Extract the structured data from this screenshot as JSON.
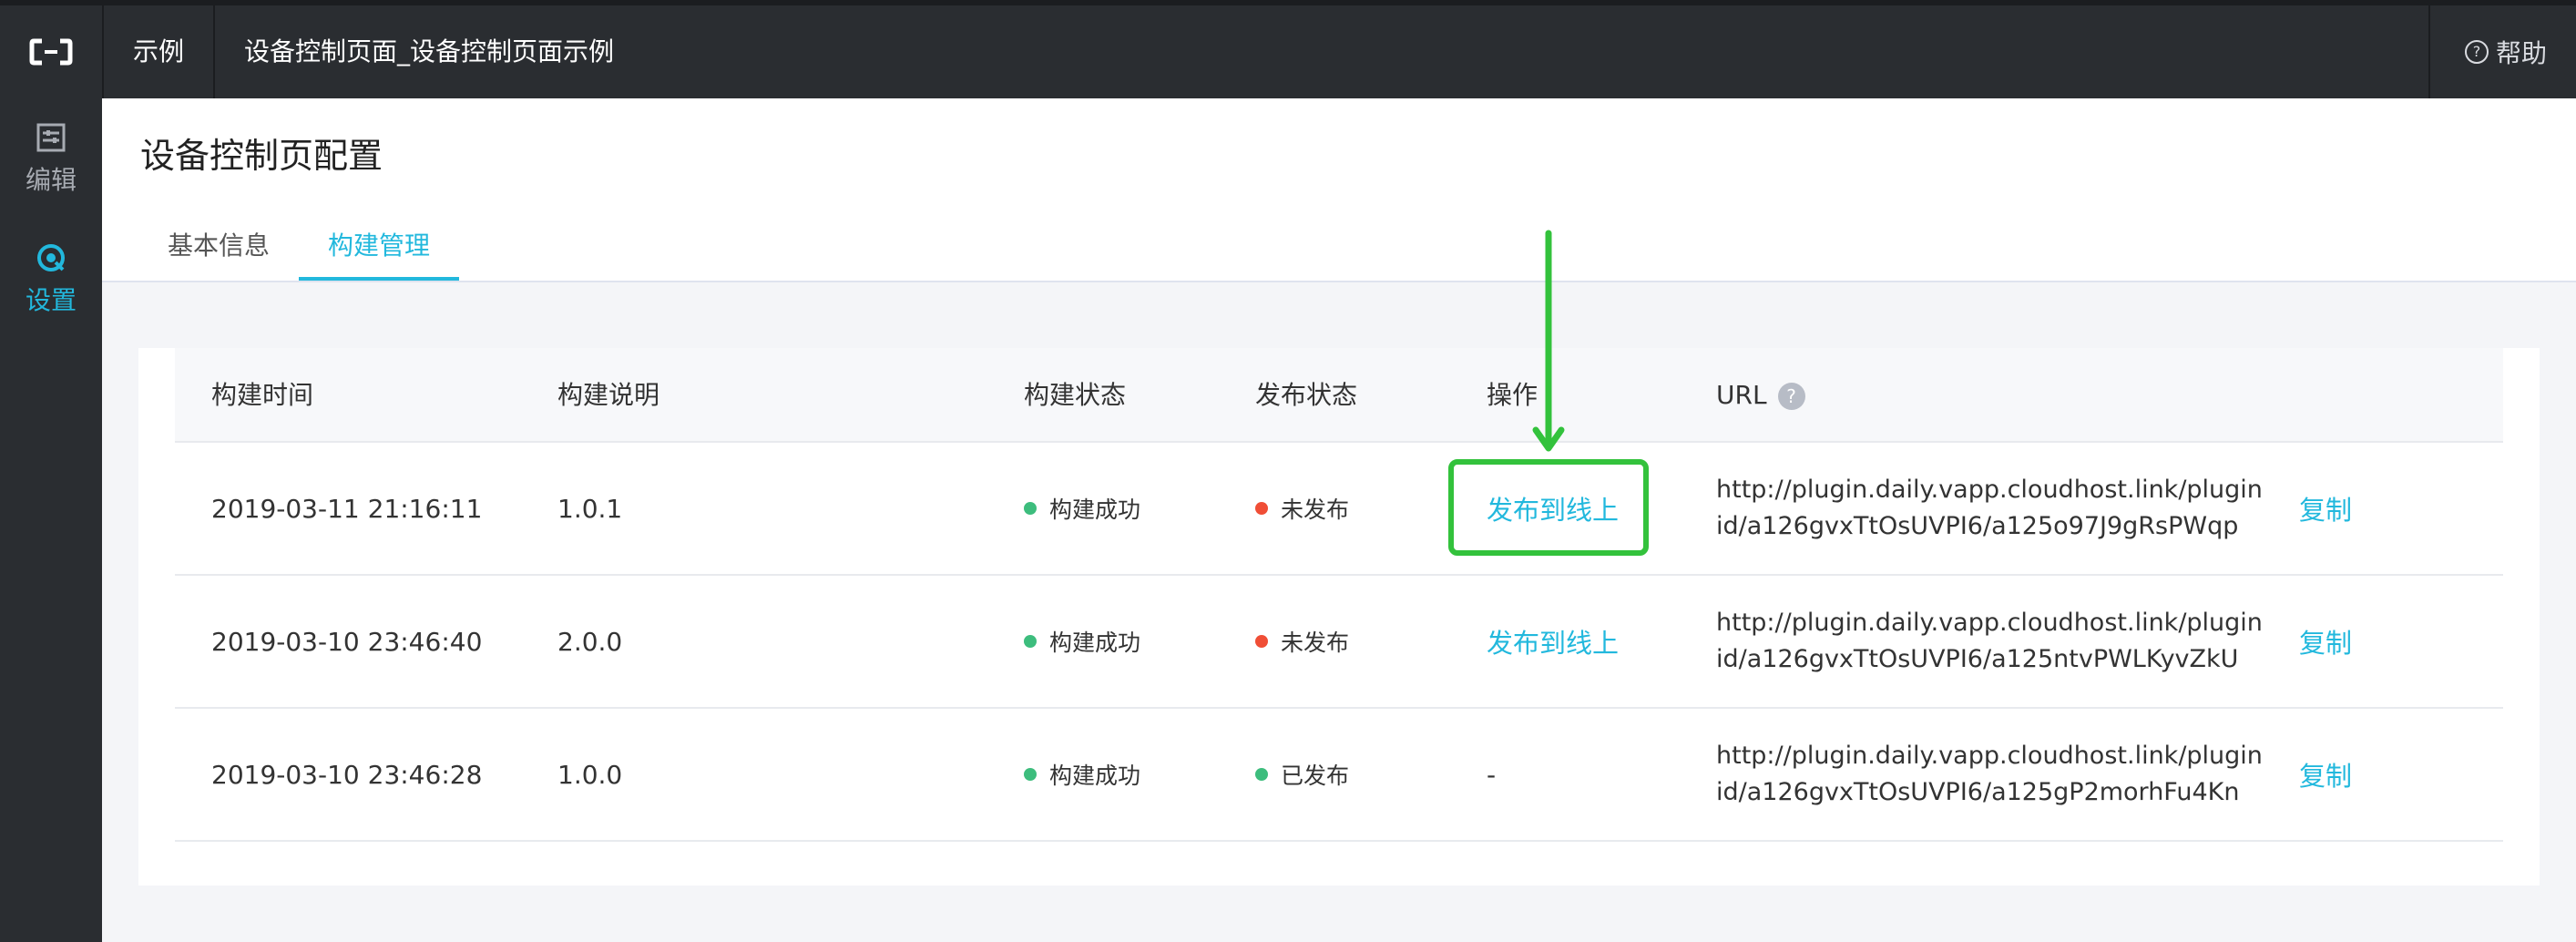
{
  "topbar": {
    "app_name": "示例",
    "breadcrumb": "设备控制页面_设备控制页面示例",
    "help_label": "帮助",
    "help_icon": "question-circle-icon"
  },
  "sidebar": {
    "items": [
      {
        "label": "编辑",
        "icon": "edit-icon",
        "active": false
      },
      {
        "label": "设置",
        "icon": "settings-icon",
        "active": true
      }
    ]
  },
  "page": {
    "title": "设备控制页配置",
    "tabs": [
      {
        "label": "基本信息",
        "active": false
      },
      {
        "label": "构建管理",
        "active": true
      }
    ]
  },
  "table": {
    "headers": {
      "build_time": "构建时间",
      "build_desc": "构建说明",
      "build_status": "构建状态",
      "publish_status": "发布状态",
      "action": "操作",
      "url": "URL",
      "url_help": "?"
    },
    "rows": [
      {
        "build_time": "2019-03-11 21:16:11",
        "build_desc": "1.0.1",
        "build_status": "构建成功",
        "build_status_color": "#3dbd7d",
        "publish_status": "未发布",
        "publish_status_color": "#f04e36",
        "action": "发布到线上",
        "url_line1": "http://plugin.daily.vapp.cloudhost.link/plugin",
        "url_line2": "id/a126gvxTtOsUVPI6/a125o97J9gRsPWqp",
        "copy": "复制"
      },
      {
        "build_time": "2019-03-10 23:46:40",
        "build_desc": "2.0.0",
        "build_status": "构建成功",
        "build_status_color": "#3dbd7d",
        "publish_status": "未发布",
        "publish_status_color": "#f04e36",
        "action": "发布到线上",
        "url_line1": "http://plugin.daily.vapp.cloudhost.link/plugin",
        "url_line2": "id/a126gvxTtOsUVPI6/a125ntvPWLKyvZkU",
        "copy": "复制"
      },
      {
        "build_time": "2019-03-10 23:46:28",
        "build_desc": "1.0.0",
        "build_status": "构建成功",
        "build_status_color": "#3dbd7d",
        "publish_status": "已发布",
        "publish_status_color": "#3dbd7d",
        "action": "-",
        "url_line1": "http://plugin.daily.vapp.cloudhost.link/plugin",
        "url_line2": "id/a126gvxTtOsUVPI6/a125gP2morhFu4Kn",
        "copy": "复制"
      }
    ]
  },
  "colors": {
    "accent": "#22b8dd",
    "topbar_bg": "#2a2d31",
    "annotation": "#33c23c"
  }
}
